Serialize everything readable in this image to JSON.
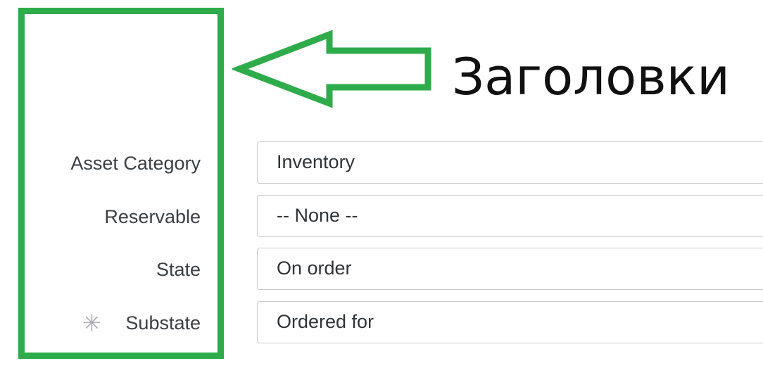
{
  "annotation": {
    "text": "Заголовки",
    "highlight_color": "#2eab4a"
  },
  "form": {
    "fields": [
      {
        "label": "Asset Category",
        "value": "Inventory",
        "required": false
      },
      {
        "label": "Reservable",
        "value": "-- None --",
        "required": false
      },
      {
        "label": "State",
        "value": "On order",
        "required": false
      },
      {
        "label": "Substate",
        "value": "Ordered for",
        "required": true,
        "required_mark": "✳"
      }
    ]
  }
}
